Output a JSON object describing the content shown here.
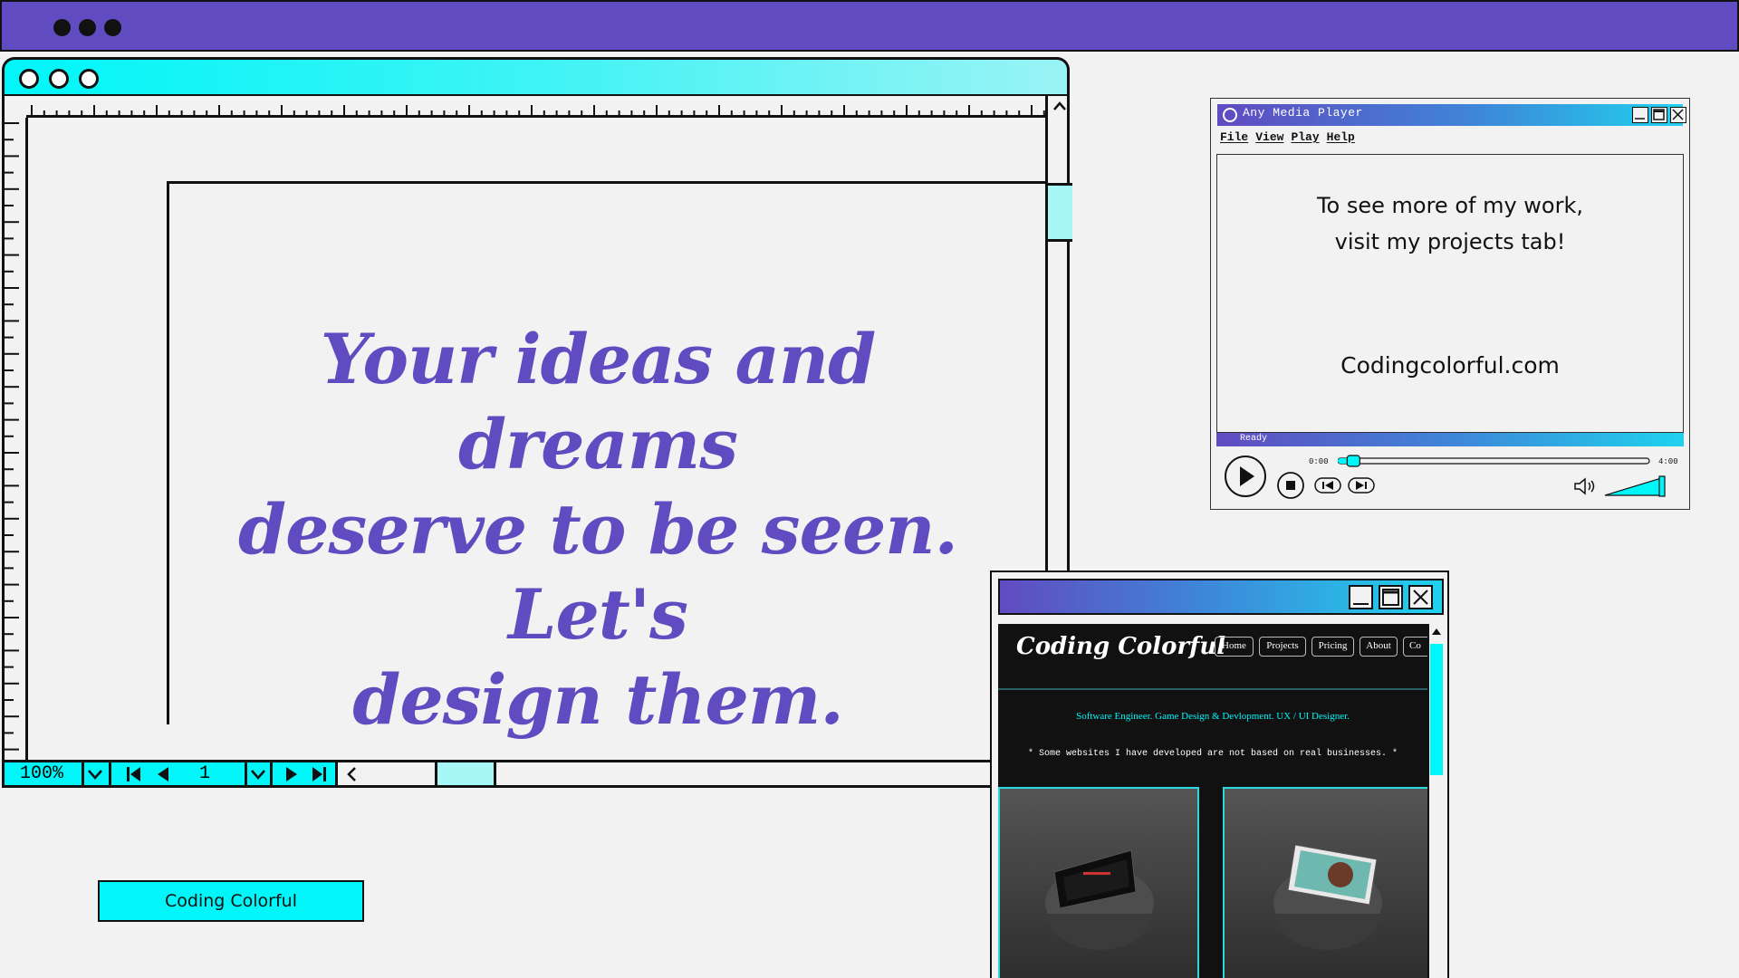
{
  "colors": {
    "purple": "#614bc1",
    "cyan": "#00f6f8",
    "background": "#f2f2f2",
    "ink": "#111111"
  },
  "headline": {
    "line1": "Your ideas and dreams",
    "line2": "deserve to be seen. Let's",
    "line3": "design them."
  },
  "design_toolbar": {
    "zoom": "100%",
    "page": "1",
    "icons": [
      "chevron-down-icon",
      "skip-first-icon",
      "prev-icon",
      "next-icon",
      "skip-last-icon",
      "chevron-left-icon"
    ]
  },
  "brand_label": "Coding Colorful",
  "media_player": {
    "title": "Any Media Player",
    "menu": [
      "File",
      "View",
      "Play",
      "Help"
    ],
    "message_line1": "To see more of my work,",
    "message_line2": "visit my projects tab!",
    "site": "Codingcolorful.com",
    "status": "Ready",
    "time_start": "0:00",
    "time_end": "4:00",
    "progress": 0.03,
    "volume": 1.0
  },
  "browser": {
    "logo": "Coding Colorful",
    "nav": [
      "Home",
      "Projects",
      "Pricing",
      "About",
      "Co"
    ],
    "tagline": "Software Engineer. Game Design & Devlopment. UX / UI Designer.",
    "note": "* Some websites I have developed are not based on real businesses. *"
  }
}
